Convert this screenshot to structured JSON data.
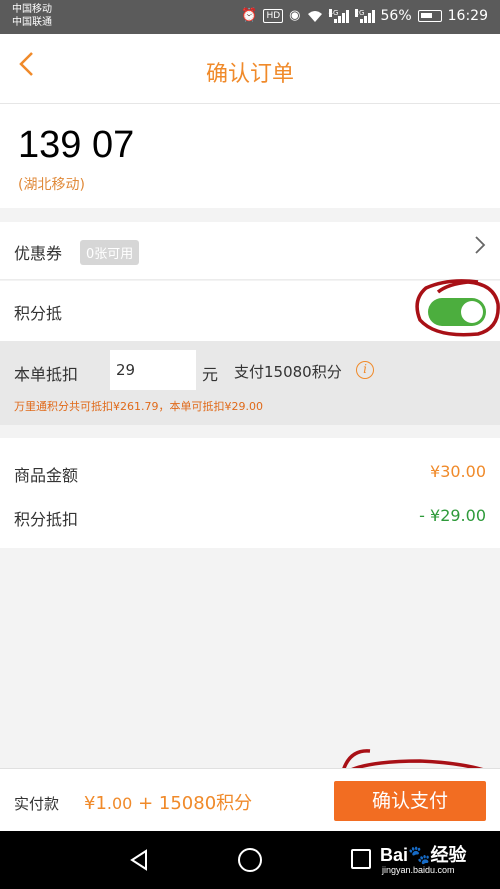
{
  "status_bar": {
    "carrier1": "中国移动",
    "carrier2": "中国联通",
    "net1": "4G",
    "net2": "2G",
    "battery": "56%",
    "time": "16:29",
    "icons": [
      "alarm-icon",
      "hd-icon",
      "eye-icon",
      "wifi-icon",
      "signal-icon",
      "battery-icon"
    ]
  },
  "header": {
    "title": "确认订单",
    "back_icon": "chevron-left-icon",
    "accent_color": "#f08a2a"
  },
  "recharge": {
    "phone": "139 07",
    "carrier": "(湖北移动)"
  },
  "coupon": {
    "label": "优惠券",
    "badge": "0张可用"
  },
  "points": {
    "label": "积分抵",
    "toggle_on": true,
    "toggle_color": "#4cae3e"
  },
  "deduction": {
    "label": "本单抵扣",
    "input_value": "29",
    "unit": "元",
    "pay_points": "支付15080积分",
    "info_icon": "i",
    "note": "万里通积分共可抵扣¥261.79，本单可抵扣¥29.00"
  },
  "summary": {
    "goods_label": "商品金额",
    "goods_value": "¥30.00",
    "points_label": "积分抵扣",
    "points_value": "- ¥29.00",
    "green_color": "#2e9a3a"
  },
  "footer": {
    "pay_label": "实付款",
    "yen": "¥1",
    "decimal": ".00",
    "plus_points": " + 15080积分",
    "confirm_button": "确认支付",
    "button_color": "#f26d22"
  },
  "watermark": {
    "brand": "Bai",
    "brand_suffix": "经验",
    "site": "jingyan.baidu.com"
  }
}
